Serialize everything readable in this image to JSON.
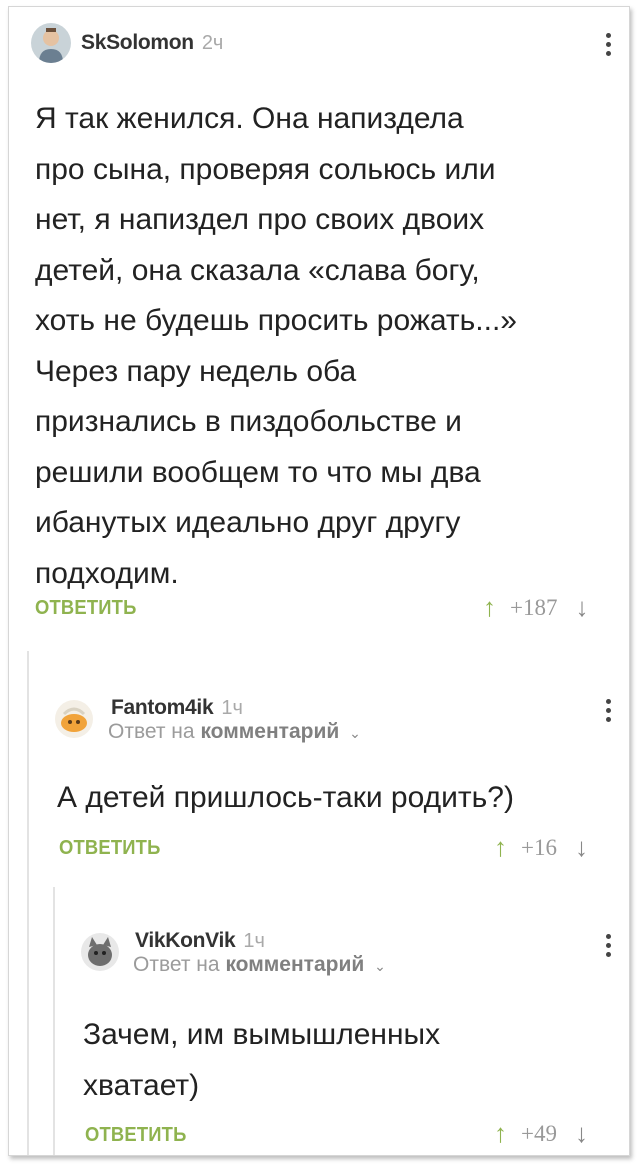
{
  "comments": [
    {
      "username": "SkSolomon",
      "time": "2ч",
      "text": "Я так женился. Она напиздела\nпро сына, проверяя сольюсь или\nнет, я напиздел про своих двоих\nдетей, она сказала «слава богу,\nхоть не будешь просить рожать...»\nЧерез пару недель оба\nпризнались в пиздобольстве и\nрешили вообщем то что мы два\nибанутых идеально друг другу\nподходим.",
      "reply_label": "ОТВЕТИТЬ",
      "score": "+187",
      "avatar_icon": "user-photo-avatar"
    },
    {
      "username": "Fantom4ik",
      "time": "1ч",
      "reply_to_prefix": "Ответ на",
      "reply_to_link": "комментарий",
      "text": "А детей пришлось-таки родить?)",
      "reply_label": "ОТВЕТИТЬ",
      "score": "+16",
      "avatar_icon": "cartoon-avatar"
    },
    {
      "username": "VikKonVik",
      "time": "1ч",
      "reply_to_prefix": "Ответ на",
      "reply_to_link": "комментарий",
      "text": "Зачем, им вымышленных\nхватает)",
      "reply_label": "ОТВЕТИТЬ",
      "score": "+49",
      "avatar_icon": "cat-avatar"
    }
  ],
  "icons": {
    "upvote": "↑",
    "downvote": "↓",
    "menu": "vertical-dots-icon",
    "chevron": "chevron-down-icon"
  },
  "colors": {
    "accent": "#8fb34f",
    "text": "#222222",
    "muted": "#a9a9a9"
  }
}
